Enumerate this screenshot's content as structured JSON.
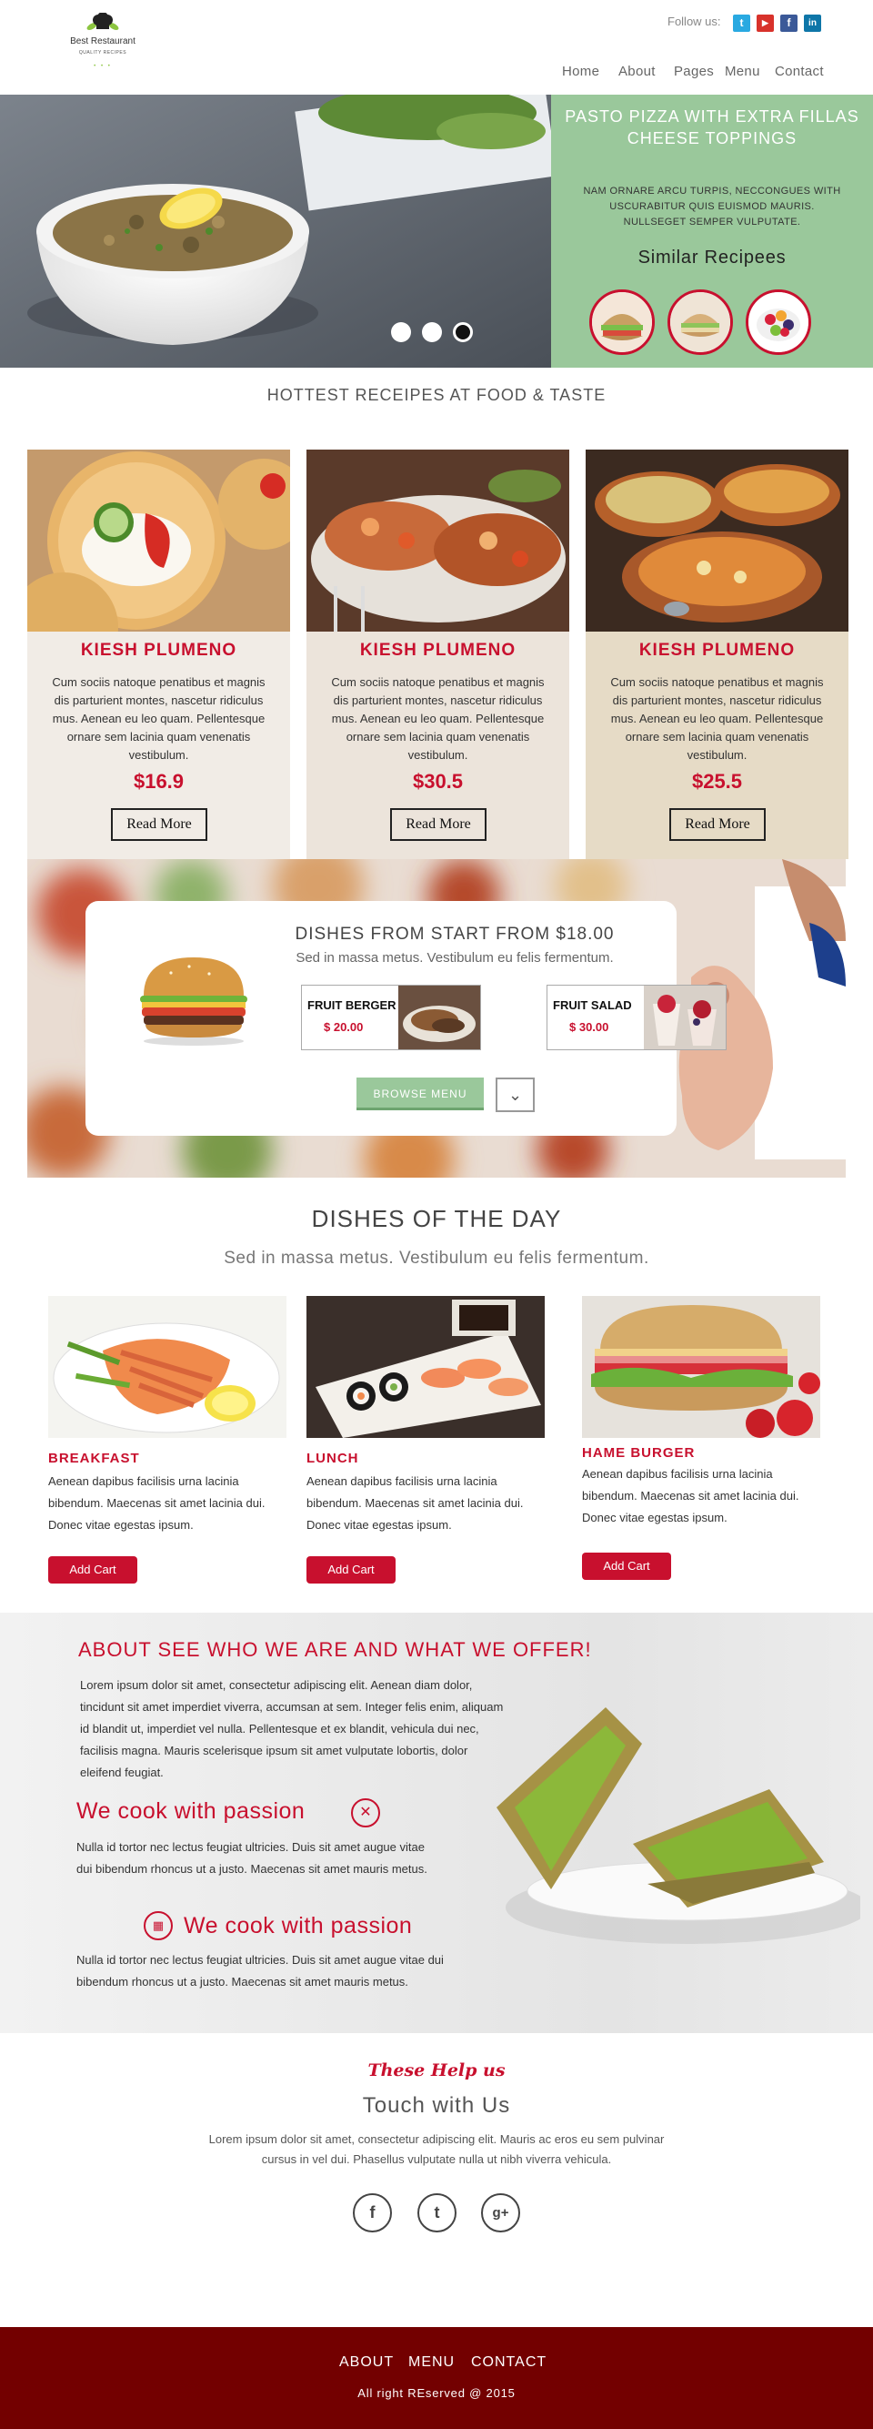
{
  "header": {
    "brand": "Best Restaurant",
    "tagline": "QUALITY RECIPES",
    "logo_dots": "• • •",
    "follow_label": "Follow us:",
    "social": [
      {
        "icon": "twitter-icon",
        "glyph": "t",
        "color": "#29a9e1"
      },
      {
        "icon": "youtube-icon",
        "glyph": "▶",
        "color": "#d8322b"
      },
      {
        "icon": "facebook-icon",
        "glyph": "f",
        "color": "#3b5998"
      },
      {
        "icon": "linkedin-icon",
        "glyph": "in",
        "color": "#0e76a8"
      }
    ],
    "nav": [
      "Home",
      "About",
      "Pages",
      "Menu",
      "Contact"
    ]
  },
  "hero": {
    "title": "PASTO PIZZA WITH EXTRA FILLAS CHEESE TOPPINGS",
    "description": "NAM ORNARE ARCU TURPIS, NECCONGUES WITH USCURABITUR QUIS EUISMOD MAURIS. NULLSEGET SEMPER VULPUTATE.",
    "similar_heading": "Similar Recipees",
    "slide_dots": 3,
    "active_dot": 3
  },
  "hottest": {
    "heading": "HOTTEST RECEIPES AT FOOD & TASTE",
    "cards": [
      {
        "title": "KIESH PLUMENO",
        "text": "Cum sociis natoque penatibus et magnis dis parturient montes, nascetur ridiculus mus. Aenean eu leo quam. Pellentesque ornare sem lacinia quam venenatis vestibulum.",
        "price": "$16.9",
        "button": "Read More",
        "bg": "#f1ece6"
      },
      {
        "title": "KIESH PLUMENO",
        "text": "Cum sociis natoque penatibus et magnis dis parturient montes, nascetur ridiculus mus. Aenean eu leo quam. Pellentesque ornare sem lacinia quam venenatis vestibulum.",
        "price": "$30.5",
        "button": "Read More",
        "bg": "#ece4db"
      },
      {
        "title": "KIESH PLUMENO",
        "text": "Cum sociis natoque penatibus et magnis dis parturient montes, nascetur ridiculus mus. Aenean eu leo quam. Pellentesque ornare sem lacinia quam venenatis vestibulum.",
        "price": "$25.5",
        "button": "Read More",
        "bg": "#e6dbc6"
      }
    ]
  },
  "dishes_band": {
    "title": "DISHES FROM START FROM $18.00",
    "subtitle": "Sed in massa metus. Vestibulum eu felis fermentum.",
    "items": [
      {
        "name": "FRUIT BERGER",
        "price": "$ 20.00"
      },
      {
        "name": "FRUIT SALAD",
        "price": "$ 30.00"
      }
    ],
    "browse_label": "BROWSE MENU",
    "down_glyph": "⌄"
  },
  "day": {
    "title": "DISHES OF THE DAY",
    "subtitle": "Sed in massa metus. Vestibulum eu felis fermentum.",
    "dishes": [
      {
        "label": "BREAKFAST",
        "text": "Aenean dapibus facilisis urna lacinia bibendum. Maecenas sit amet lacinia dui. Donec vitae egestas ipsum.",
        "button": "Add Cart"
      },
      {
        "label": "LUNCH",
        "text": "Aenean dapibus facilisis urna lacinia bibendum. Maecenas sit amet lacinia dui. Donec vitae egestas ipsum.",
        "button": "Add Cart"
      },
      {
        "label": "HAME BURGER",
        "text": "Aenean dapibus facilisis urna lacinia bibendum. Maecenas sit amet lacinia dui. Donec vitae egestas ipsum.",
        "button": "Add Cart"
      }
    ]
  },
  "about": {
    "title": "ABOUT SEE WHO WE ARE AND WHAT WE OFFER!",
    "text": "Lorem ipsum dolor sit amet, consectetur adipiscing elit. Aenean diam dolor, tincidunt sit amet imperdiet viverra, accumsan at sem. Integer felis enim, aliquam id blandit ut, imperdiet vel nulla. Pellentesque et ex blandit, vehicula dui nec, facilisis magna. Mauris scelerisque ipsum sit amet vulputate lobortis, dolor eleifend feugiat.",
    "cook1_title": "We cook with passion",
    "cook1_text": "Nulla id tortor nec lectus feugiat ultricies. Duis sit amet augue vitae dui bibendum rhoncus ut a justo. Maecenas sit amet mauris metus.",
    "cook2_title": "We cook with passion",
    "cook2_text": "Nulla id tortor nec lectus feugiat ultricies. Duis sit amet augue vitae dui bibendum rhoncus ut a justo. Maecenas sit amet mauris metus."
  },
  "contact": {
    "script_heading": "These Help us",
    "title": "Touch with Us",
    "text": "Lorem ipsum dolor sit amet, consectetur adipiscing elit. Mauris ac eros eu sem pulvinar cursus in vel dui. Phasellus vulputate nulla ut nibh viverra vehicula.",
    "social": [
      {
        "icon": "facebook-icon",
        "glyph": "f"
      },
      {
        "icon": "twitter-icon",
        "glyph": "t"
      },
      {
        "icon": "google-plus-icon",
        "glyph": "g+"
      }
    ]
  },
  "footer": {
    "links": [
      "ABOUT",
      "MENU",
      "CONTACT"
    ],
    "copyright": "All right REserved @ 2015"
  },
  "colors": {
    "accent": "#c8102e",
    "green": "#9ac89b",
    "footer": "#730000"
  }
}
